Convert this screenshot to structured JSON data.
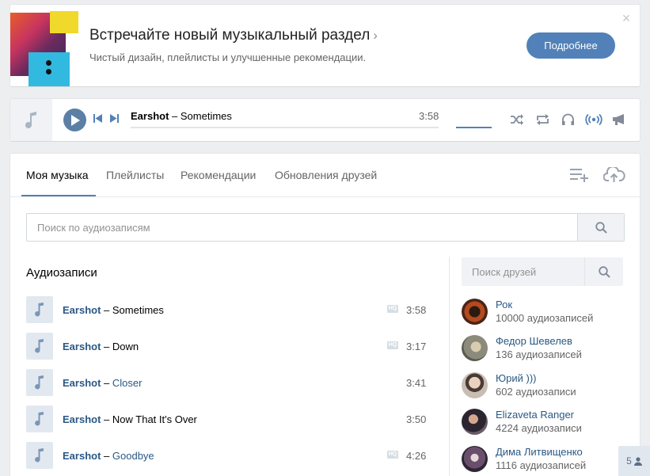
{
  "promo": {
    "title": "Встречайте новый музыкальный раздел",
    "chevron": "›",
    "subtitle": "Чистый дизайн, плейлисты и улучшенные рекомендации.",
    "button": "Подробнее",
    "close": "×",
    "colors": {
      "accent": "#5181b8"
    }
  },
  "player": {
    "artist": "Earshot",
    "separator": " – ",
    "song": "Sometimes",
    "duration": "3:58",
    "progress": 0,
    "volume": 1.0,
    "icons": [
      "note-icon",
      "play-icon",
      "previous-icon",
      "next-icon",
      "shuffle-icon",
      "repeat-icon",
      "headphones-icon",
      "broadcast-icon",
      "megaphone-icon"
    ]
  },
  "tabs": [
    {
      "label": "Моя музыка",
      "active": true
    },
    {
      "label": "Плейлисты",
      "active": false
    },
    {
      "label": "Рекомендации",
      "active": false
    },
    {
      "label": "Обновления друзей",
      "active": false
    }
  ],
  "search": {
    "placeholder": "Поиск по аудиозаписям"
  },
  "section_title": "Аудиозаписи",
  "tracks": [
    {
      "artist": "Earshot",
      "dash": "–",
      "song": "Sometimes",
      "song_link": false,
      "hq": true,
      "hq_label": "HQ",
      "duration": "3:58"
    },
    {
      "artist": "Earshot",
      "dash": "–",
      "song": "Down",
      "song_link": false,
      "hq": true,
      "hq_label": "HQ",
      "duration": "3:17"
    },
    {
      "artist": "Earshot",
      "dash": "–",
      "song": "Closer",
      "song_link": true,
      "hq": false,
      "hq_label": "",
      "duration": "3:41"
    },
    {
      "artist": "Earshot",
      "dash": "–",
      "song": "Now That It's Over",
      "song_link": false,
      "hq": false,
      "hq_label": "",
      "duration": "3:50"
    },
    {
      "artist": "Earshot",
      "dash": "–",
      "song": "Goodbye",
      "song_link": true,
      "hq": true,
      "hq_label": "HQ",
      "duration": "4:26"
    }
  ],
  "friends_search": {
    "placeholder": "Поиск друзей"
  },
  "friends": [
    {
      "name": "Рок",
      "count": "10000 аудиозаписей",
      "avatar_color": "#8a2a1e"
    },
    {
      "name": "Федор Шевелев",
      "count": "136 аудиозаписей",
      "avatar_color": "#8c8a7a"
    },
    {
      "name": "Юрий )))",
      "count": "602 аудиозаписи",
      "avatar_color": "#b9a79a"
    },
    {
      "name": "Elizaveta Ranger",
      "count": "4224 аудиозаписи",
      "avatar_color": "#3d3a42"
    },
    {
      "name": "Дима Литвищенко",
      "count": "1116 аудиозаписей",
      "avatar_color": "#4b3b4f"
    }
  ],
  "online_badge": {
    "count": "5"
  }
}
